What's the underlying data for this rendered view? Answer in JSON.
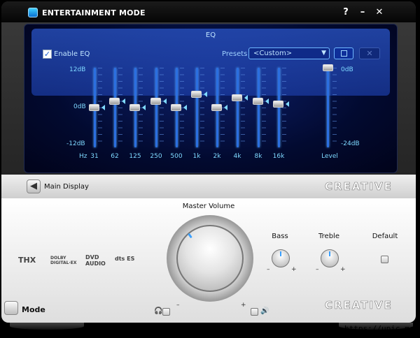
{
  "window": {
    "title": "ENTERTAINMENT MODE",
    "help": "?",
    "minimize": "–",
    "close": "✕"
  },
  "eq": {
    "title": "EQ",
    "enable_label": "Enable EQ",
    "enable_checked": true,
    "presets_label": "Presets",
    "preset_value": "<Custom>",
    "db_top": "12dB",
    "db_mid": "0dB",
    "db_bot": "-12dB",
    "hz_label": "Hz",
    "bands": [
      "31",
      "62",
      "125",
      "250",
      "500",
      "1k",
      "2k",
      "4k",
      "8k",
      "16k"
    ],
    "band_gains_db": [
      0,
      2,
      0,
      2,
      0,
      4,
      0,
      3,
      2,
      1
    ],
    "level_top": "0dB",
    "level_bottom": "-24dB",
    "level_label": "Level",
    "level_db": 0
  },
  "nav": {
    "main_display": "Main Display"
  },
  "brand": {
    "logo": "CREATIVE"
  },
  "controls": {
    "master_volume": "Master Volume",
    "bass": "Bass",
    "treble": "Treble",
    "default": "Default",
    "minus": "–",
    "plus": "+"
  },
  "logos": {
    "thx": "THX",
    "dolby": "DOLBY DIGITAL·EX",
    "dvd": "DVD AUDIO",
    "dts": "dts ES"
  },
  "mode": {
    "label": "Mode"
  },
  "watermark": "[609x472] https://upic.me/",
  "colors": {
    "accent": "#3aa0ff",
    "eq_text": "#7fd9ff",
    "screen": "#020a30"
  }
}
